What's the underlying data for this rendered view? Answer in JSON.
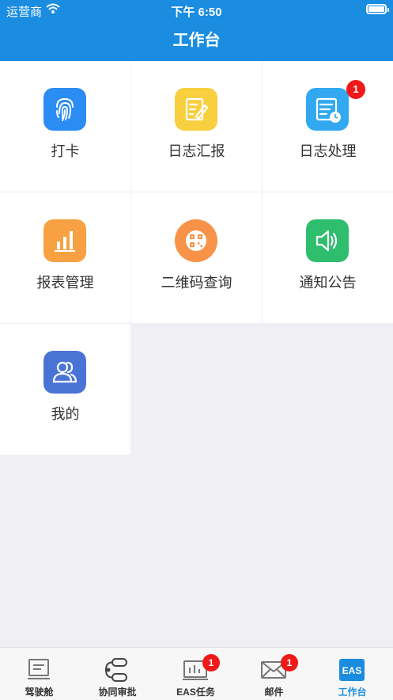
{
  "status_bar": {
    "carrier": "运营商",
    "time": "下午 6:50"
  },
  "header": {
    "title": "工作台"
  },
  "grid_items": [
    {
      "label": "打卡",
      "icon": "fingerprint-icon",
      "color": "#2b8cf4",
      "badge": ""
    },
    {
      "label": "日志汇报",
      "icon": "edit-note-icon",
      "color": "#f8cf3e",
      "badge": ""
    },
    {
      "label": "日志处理",
      "icon": "document-clock-icon",
      "color": "#31a8f0",
      "badge": "1"
    },
    {
      "label": "报表管理",
      "icon": "bar-chart-icon",
      "color": "#f7a142",
      "badge": ""
    },
    {
      "label": "二维码查询",
      "icon": "qr-code-icon",
      "color": "#f79248",
      "badge": ""
    },
    {
      "label": "通知公告",
      "icon": "speaker-icon",
      "color": "#2fbd6e",
      "badge": ""
    },
    {
      "label": "我的",
      "icon": "users-icon",
      "color": "#4a73d6",
      "badge": ""
    }
  ],
  "tabs": [
    {
      "label": "驾驶舱",
      "icon": "monitor-icon",
      "badge": ""
    },
    {
      "label": "协同审批",
      "icon": "workflow-icon",
      "badge": ""
    },
    {
      "label": "EAS任务",
      "icon": "task-chart-icon",
      "badge": "1"
    },
    {
      "label": "邮件",
      "icon": "mail-icon",
      "badge": "1"
    },
    {
      "label": "工作台",
      "icon": "eas-logo-icon",
      "badge": "",
      "active": true,
      "logo_text": "EAS"
    }
  ],
  "colors": {
    "brand": "#1a8de0",
    "badge": "#f01818"
  }
}
